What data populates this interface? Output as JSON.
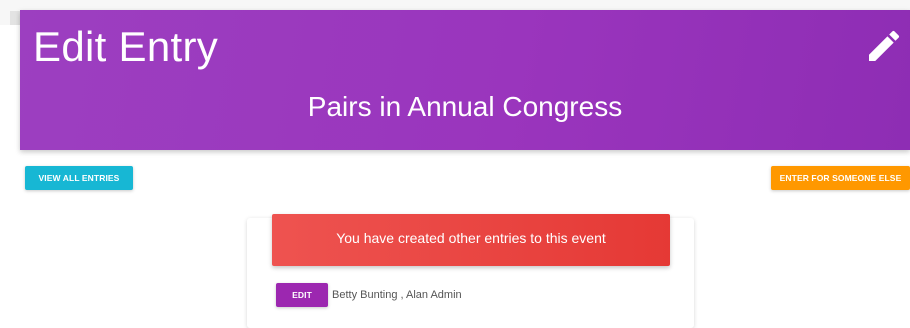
{
  "header": {
    "title": "Edit Entry",
    "subtitle": "Pairs in Annual Congress",
    "icon": "pencil-icon"
  },
  "actions": {
    "view_all_label": "VIEW ALL ENTRIES",
    "enter_for_someone_else_label": "ENTER FOR SOMEONE ELSE"
  },
  "alert": {
    "message": "You have created other entries to this event"
  },
  "entries": [
    {
      "edit_label": "EDIT",
      "names": "Betty Bunting , Alan Admin"
    }
  ],
  "colors": {
    "header": "#9c3fc0",
    "view_button": "#17b7d4",
    "enter_button": "#ff9800",
    "alert": "#e53935",
    "edit_button": "#9c27b0"
  }
}
